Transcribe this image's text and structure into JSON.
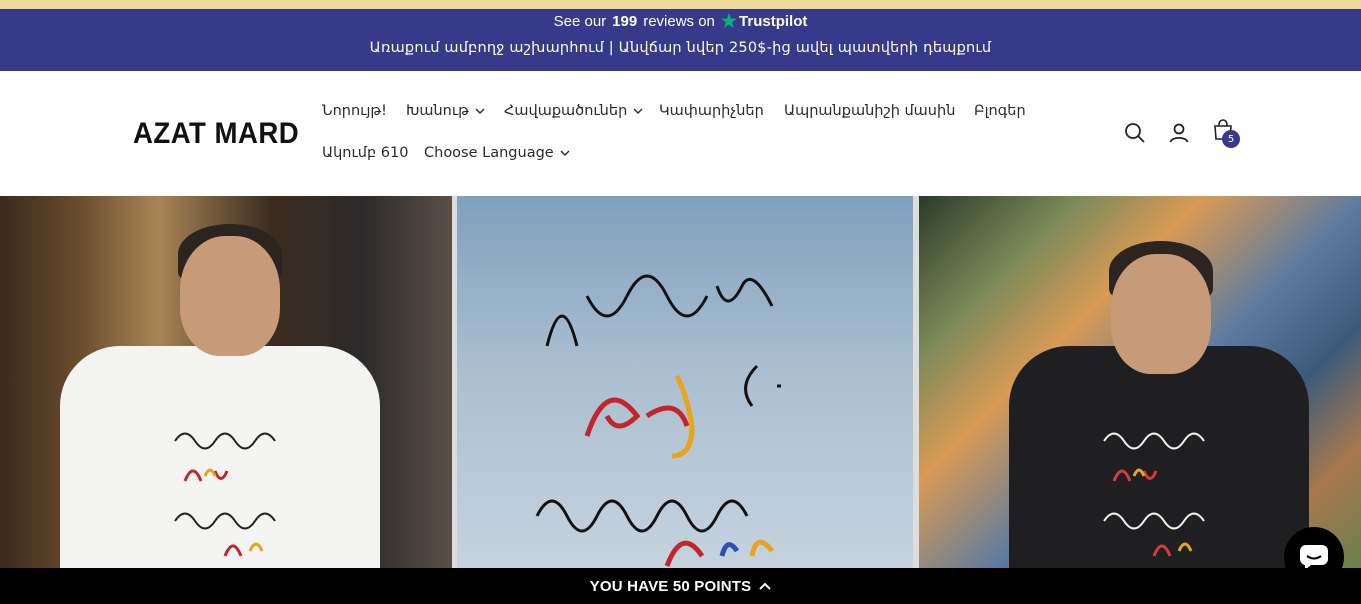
{
  "announcement": {
    "trustpilot_prefix": "See our",
    "trustpilot_count": "199",
    "trustpilot_suffix": "reviews on",
    "trustpilot_brand": "Trustpilot",
    "shipping_text": "Առաքում ամբողջ աշխարհում | Անվճար նվեր 250$-ից ավել պատվերի դեպքում"
  },
  "header": {
    "logo": "AZAT MARD",
    "nav": [
      {
        "label": "Նորույթ!"
      },
      {
        "label": "Խանութ"
      },
      {
        "label": "Հավաքածուներ"
      },
      {
        "label": "Կափարիչներ"
      },
      {
        "label": "Ապրանքանիշի մասին"
      },
      {
        "label": "Բլոգեր"
      },
      {
        "label": "Ակումբ 610"
      },
      {
        "label": "Choose Language"
      }
    ],
    "cart_count": "5"
  },
  "hero": {
    "icons": [
      "shirt-back-image",
      "script-print-image",
      "shirt-back-image"
    ]
  },
  "points_bar": {
    "label": "YOU HAVE 50 POINTS"
  },
  "colors": {
    "accent": "#37398b",
    "top_strip": "#f2d998",
    "trustpilot_star": "#00b67a"
  }
}
